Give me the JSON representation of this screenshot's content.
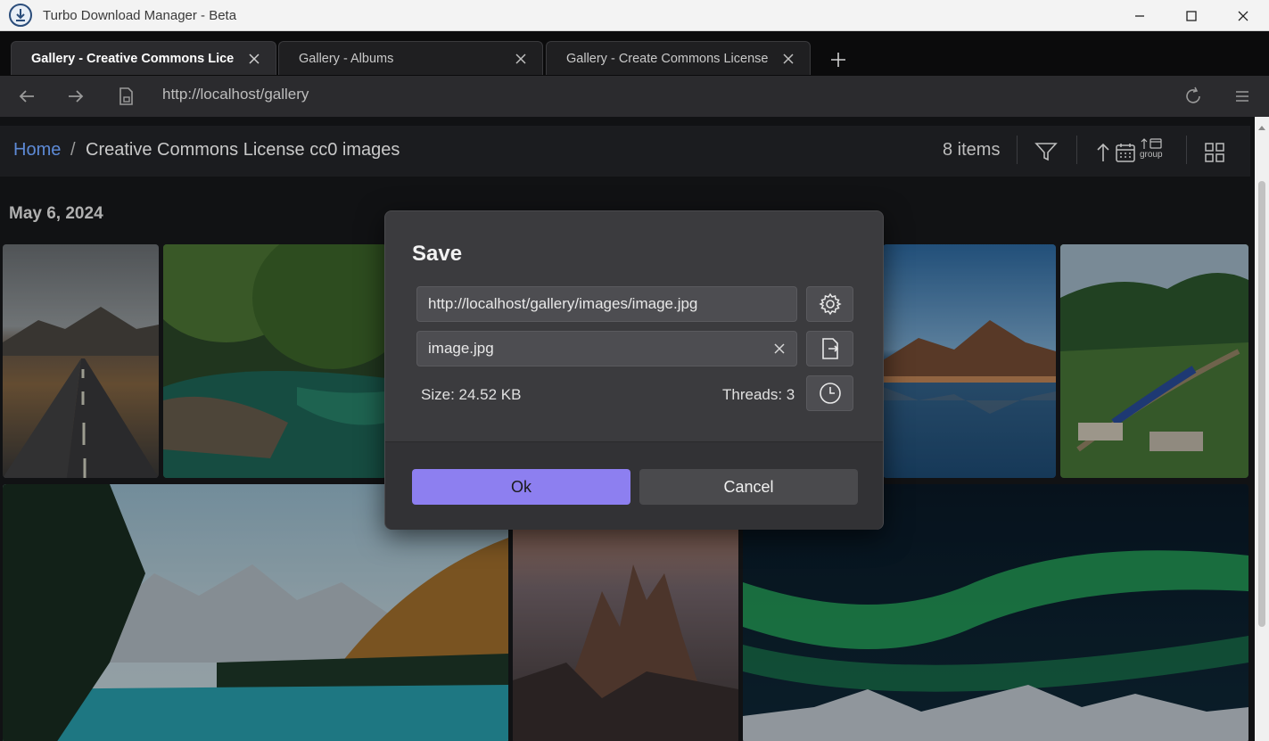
{
  "window": {
    "title": "Turbo Download Manager - Beta"
  },
  "tabs": [
    {
      "label": "Gallery - Creative Commons Licer",
      "active": true
    },
    {
      "label": "Gallery - Albums",
      "active": false
    },
    {
      "label": "Gallery - Create Commons License",
      "active": false
    }
  ],
  "address": {
    "url": "http://localhost/gallery"
  },
  "breadcrumb": {
    "home": "Home",
    "separator": "/",
    "current": "Creative Commons License cc0 images"
  },
  "toolbar": {
    "items_count": "8 items",
    "group_label": "group"
  },
  "gallery": {
    "date_heading": "May 6, 2024"
  },
  "dialog": {
    "title": "Save",
    "url_value": "http://localhost/gallery/images/image.jpg",
    "filename_value": "image.jpg",
    "size_text": "Size: 24.52 KB",
    "threads_text": "Threads: 3",
    "ok_label": "Ok",
    "cancel_label": "Cancel"
  },
  "colors": {
    "accent": "#8d7ff0",
    "link": "#5d8ad6"
  }
}
